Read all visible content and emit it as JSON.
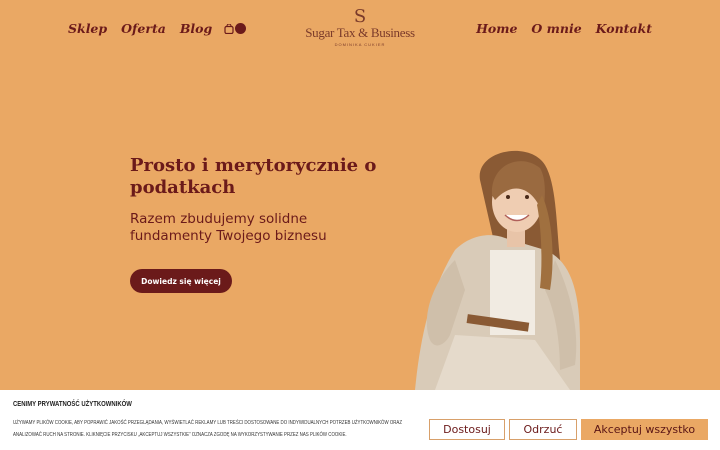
{
  "nav": {
    "left": [
      "Sklep",
      "Oferta",
      "Blog"
    ],
    "right": [
      "Home",
      "O mnie",
      "Kontakt"
    ]
  },
  "logo": {
    "mark": "S",
    "name": "Sugar Tax & Business",
    "sub": "DOMINIKA CUKIER"
  },
  "hero": {
    "title": "Prosto i merytorycznie o podatkach",
    "subtitle": "Razem zbudujemy solidne fundamenty Twojego biznesu",
    "cta": "Dowiedz się więcej"
  },
  "cookie": {
    "title": "CENIMY PRYWATNOŚĆ UŻYTKOWNIKÓW",
    "text": "UŻYWAMY PLIKÓW COOKIE, ABY POPRAWIĆ JAKOŚĆ PRZEGLĄDANIA, WYŚWIETLAĆ REKLAMY LUB TREŚCI DOSTOSOWANE DO INDYWIDUALNYCH POTRZEB UŻYTKOWNIKÓW ORAZ ANALIZOWAĆ RUCH NA STRONIE. KLIKNIĘCIE PRZYCISKU „AKCEPTUJ WSZYSTKIE” OZNACZA ZGODĘ NA WYKORZYSTYWANIE PRZEZ NAS PLIKÓW COOKIE.",
    "buttons": {
      "customize": "Dostosuj",
      "reject": "Odrzuć",
      "accept": "Akceptuj wszystko"
    }
  },
  "colors": {
    "background": "#eaa864",
    "accent": "#6b1a1a"
  }
}
